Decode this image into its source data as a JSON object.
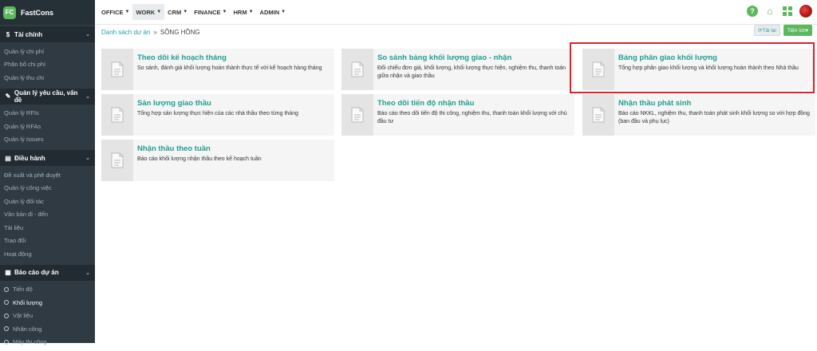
{
  "brand": {
    "logo_text": "FC",
    "name": "FastCons"
  },
  "sidebar": {
    "sections": [
      {
        "icon": "$",
        "icon_name": "dollar-icon",
        "title": "Tài chính",
        "items": [
          {
            "label": "Quản lý chi phí"
          },
          {
            "label": "Phân bổ chi phí"
          },
          {
            "label": "Quản lý thu chi"
          }
        ]
      },
      {
        "icon": "✎",
        "icon_name": "edit-icon",
        "title": "Quản lý yêu cầu, vấn đề",
        "items": [
          {
            "label": "Quản lý RFIs"
          },
          {
            "label": "Quản lý RFAs"
          },
          {
            "label": "Quản lý Issues"
          }
        ]
      },
      {
        "icon": "▤",
        "icon_name": "list-icon",
        "title": "Điều hành",
        "items": [
          {
            "label": "Đề xuất và phê duyệt"
          },
          {
            "label": "Quản lý công việc"
          },
          {
            "label": "Quản lý đối tác"
          },
          {
            "label": "Văn bản đi - đến"
          },
          {
            "label": "Tài liệu"
          },
          {
            "label": "Trao đổi"
          },
          {
            "label": "Hoạt động"
          }
        ]
      },
      {
        "icon": "▦",
        "icon_name": "report-icon",
        "title": "Báo cáo dự án",
        "items": [
          {
            "label": "Tiến độ"
          },
          {
            "label": "Khối lượng",
            "active": true
          },
          {
            "label": "Vật liệu"
          },
          {
            "label": "Nhân công"
          },
          {
            "label": "Máy thi công"
          }
        ]
      }
    ]
  },
  "topmenu": [
    {
      "label": "OFFICE"
    },
    {
      "label": "WORK",
      "active": true
    },
    {
      "label": "CRM"
    },
    {
      "label": "FINANCE"
    },
    {
      "label": "HRM"
    },
    {
      "label": "ADMIN"
    }
  ],
  "breadcrumb": {
    "link": "Danh sách dự án",
    "separator": "»",
    "current": "SÔNG HỒNG"
  },
  "actions": {
    "reload": "Tải lại",
    "tools": "Tiện ích"
  },
  "cards": [
    {
      "title": "Theo dõi kế hoạch tháng",
      "desc": "So sánh, đánh giá khối lượng hoàn thành thực tế với kế hoạch hàng tháng"
    },
    {
      "title": "So sánh bảng khối lượng giao - nhận",
      "desc": "Đối chiếu đơn giá, khối lượng, khối lượng thực hiện, nghiệm thu, thanh toán giữa nhận và giao thầu"
    },
    {
      "title": "Bảng phân giao khối lượng",
      "desc": "Tổng hợp phân giao khối lượng và khối lượng hoàn thành theo Nhà thầu"
    },
    {
      "title": "Sản lượng giao thầu",
      "desc": "Tổng hợp sản lượng thực hiện của các nhà thầu theo từng tháng"
    },
    {
      "title": "Theo dõi tiến độ nhận thầu",
      "desc": "Báo cáo theo dõi tiến độ thi công, nghiệm thu, thanh toán khối lượng với chủ đầu tư"
    },
    {
      "title": "Nhận thầu phát sinh",
      "desc": "Báo cáo NKKL, nghiệm thu, thanh toán phát sinh khối lượng so với hợp đồng (ban đầu và phụ lục)"
    },
    {
      "title": "Nhận thầu theo tuần",
      "desc": "Báo cáo khối lượng nhận thầu theo kế hoạch tuần"
    }
  ],
  "colors": {
    "accent": "#1f9e8f",
    "green": "#5cb85c",
    "sidebar": "#2f3a42",
    "highlight": "#d9232d"
  }
}
